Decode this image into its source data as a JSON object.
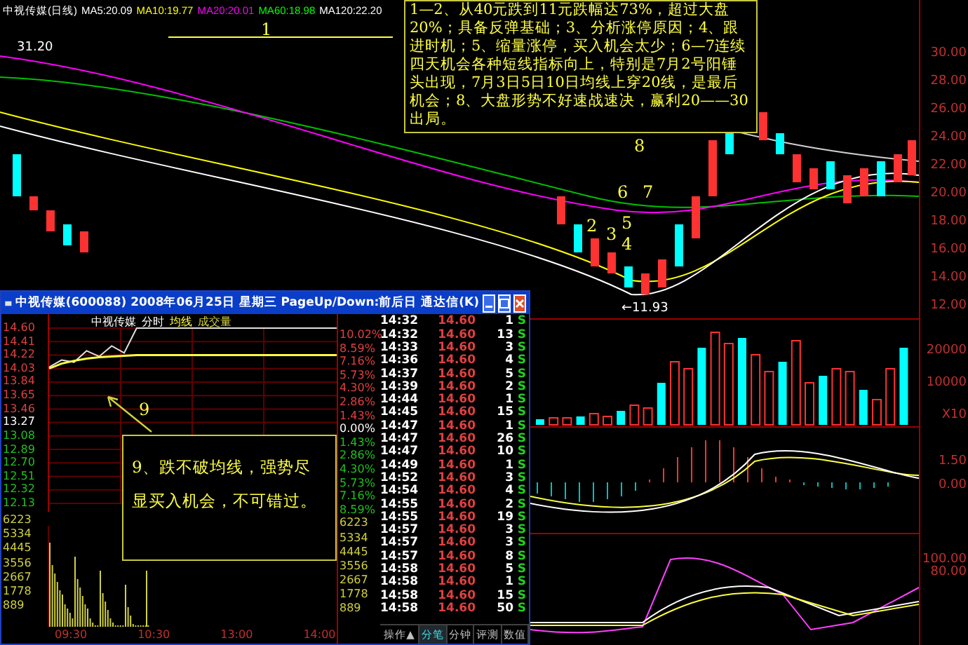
{
  "kline": {
    "title": "中视传媒(日线)",
    "ma": [
      {
        "label": "MA5:20.09",
        "color": "#ffffff"
      },
      {
        "label": "MA10:19.77",
        "color": "#ffff00"
      },
      {
        "label": "MA20:20.01",
        "color": "#ff00ff"
      },
      {
        "label": "MA60:18.98",
        "color": "#00ff00"
      },
      {
        "label": "MA120:22.20",
        "color": "#ffffff"
      }
    ],
    "high_label": "31.20",
    "low_label": "←11.93",
    "line_label": "1",
    "note": "1—2、从40元跌到11元跌幅达73%，超过大盘20%；具备反弹基础；3、分析涨停原因；4、跟进时机；5、缩量涨停，买入机会太少；6—7连续四天机会各种短线指标向上，特别是7月2号阳锤头出现，7月3日5日10日均线上穿20线，是最后机会；8、大盘形势不好速战速决，赢利20——30出局。",
    "marks": [
      "8",
      "6",
      "7",
      "5",
      "2",
      "3",
      "4"
    ],
    "yticks": [
      "30.00",
      "28.00",
      "26.00",
      "24.00",
      "22.00",
      "20.00",
      "18.00",
      "16.00",
      "14.00",
      "12.00"
    ],
    "volume_ticks": [
      "20000",
      "10000"
    ],
    "volume_unit": "X10",
    "macd_ticks": [
      "1.50",
      "0.00"
    ],
    "kdj_ticks": [
      "100.00",
      "80.00"
    ]
  },
  "window": {
    "title": "中视传媒(600088)  2008年06月25日  星期三  PageUp/Down:前后日  通达信(K)",
    "stock_name": "中视传媒",
    "volume_legend": "成交量",
    "chart_data": {
      "type": "line",
      "grid": true,
      "yticks": [
        {
          "value": 14.6,
          "label": "14.60"
        },
        {
          "value": 14.41,
          "label": "14.41"
        },
        {
          "value": 14.22,
          "label": "14.22"
        },
        {
          "value": 14.03,
          "label": "14.03"
        },
        {
          "value": 13.84,
          "label": "13.84"
        },
        {
          "value": 13.65,
          "label": "13.65"
        },
        {
          "value": 13.46,
          "label": "13.46"
        },
        {
          "value": 13.27,
          "label": "13.27"
        },
        {
          "value": 13.08,
          "label": "13.08"
        },
        {
          "value": 12.89,
          "label": "12.89"
        },
        {
          "value": 12.7,
          "label": "12.70"
        },
        {
          "value": 12.51,
          "label": "12.51"
        },
        {
          "value": 12.32,
          "label": "12.32"
        },
        {
          "value": 12.13,
          "label": "12.13"
        }
      ],
      "ylim": [
        12.13,
        14.6
      ],
      "series": [
        {
          "name": "分时",
          "color": "#e0e0e0",
          "values": [
            14.05,
            14.15,
            14.12,
            14.28,
            14.2,
            14.35,
            14.25,
            14.6,
            14.6,
            14.6,
            14.6,
            14.6,
            14.6,
            14.6,
            14.6,
            14.6,
            14.6,
            14.6,
            14.6,
            14.6,
            14.6,
            14.6,
            14.6,
            14.6
          ]
        },
        {
          "name": "均线",
          "color": "#ffff40",
          "values": [
            14.03,
            14.1,
            14.14,
            14.17,
            14.19,
            14.2,
            14.21,
            14.22,
            14.22,
            14.22,
            14.22,
            14.22,
            14.22,
            14.22,
            14.22,
            14.22,
            14.22,
            14.22,
            14.22,
            14.22,
            14.22,
            14.22,
            14.22,
            14.22
          ]
        }
      ]
    },
    "pct_ticks": [
      "10.02%",
      "8.59%",
      "7.16%",
      "5.73%",
      "4.30%",
      "2.86%",
      "1.43%",
      "0.00%",
      "1.43%",
      "2.86%",
      "4.30%",
      "5.73%",
      "7.16%",
      "8.59%"
    ],
    "left_vol_ticks": [
      "6223",
      "5334",
      "4445",
      "3556",
      "2667",
      "1778",
      "889"
    ],
    "right_vol_ticks": [
      "6223",
      "5334",
      "4445",
      "3556",
      "2667",
      "1778",
      "889"
    ],
    "time_ticks": [
      "09:30",
      "10:30",
      "13:00",
      "14:00"
    ],
    "callout_mark": "9",
    "callout": "9、跌不破均线，强势尽显买入机会，不可错过。",
    "ticks": [
      {
        "time": "14:32",
        "price": "14.60",
        "volume": "1",
        "side": "S"
      },
      {
        "time": "14:32",
        "price": "14.60",
        "volume": "13",
        "side": "S"
      },
      {
        "time": "14:33",
        "price": "14.60",
        "volume": "3",
        "side": "S"
      },
      {
        "time": "14:36",
        "price": "14.60",
        "volume": "4",
        "side": "S"
      },
      {
        "time": "14:37",
        "price": "14.60",
        "volume": "5",
        "side": "S"
      },
      {
        "time": "14:39",
        "price": "14.60",
        "volume": "2",
        "side": "S"
      },
      {
        "time": "14:44",
        "price": "14.60",
        "volume": "1",
        "side": "S"
      },
      {
        "time": "14:45",
        "price": "14.60",
        "volume": "15",
        "side": "S"
      },
      {
        "time": "14:47",
        "price": "14.60",
        "volume": "1",
        "side": "S"
      },
      {
        "time": "14:47",
        "price": "14.60",
        "volume": "26",
        "side": "S"
      },
      {
        "time": "14:47",
        "price": "14.60",
        "volume": "10",
        "side": "S"
      },
      {
        "time": "14:49",
        "price": "14.60",
        "volume": "1",
        "side": "S"
      },
      {
        "time": "14:52",
        "price": "14.60",
        "volume": "3",
        "side": "S"
      },
      {
        "time": "14:54",
        "price": "14.60",
        "volume": "4",
        "side": "S"
      },
      {
        "time": "14:55",
        "price": "14.60",
        "volume": "2",
        "side": "S"
      },
      {
        "time": "14:55",
        "price": "14.60",
        "volume": "19",
        "side": "S"
      },
      {
        "time": "14:57",
        "price": "14.60",
        "volume": "3",
        "side": "S"
      },
      {
        "time": "14:57",
        "price": "14.60",
        "volume": "3",
        "side": "S"
      },
      {
        "time": "14:57",
        "price": "14.60",
        "volume": "8",
        "side": "S"
      },
      {
        "time": "14:58",
        "price": "14.60",
        "volume": "5",
        "side": "S"
      },
      {
        "time": "14:58",
        "price": "14.60",
        "volume": "1",
        "side": "S"
      },
      {
        "time": "14:58",
        "price": "14.60",
        "volume": "15",
        "side": "S"
      },
      {
        "time": "14:58",
        "price": "14.60",
        "volume": "50",
        "side": "S"
      }
    ],
    "tabs": [
      {
        "label": "操作▲",
        "selected": false
      },
      {
        "label": "分笔",
        "selected": true
      },
      {
        "label": "分钟",
        "selected": false
      },
      {
        "label": "评测",
        "selected": false
      },
      {
        "label": "数值",
        "selected": false
      }
    ]
  }
}
